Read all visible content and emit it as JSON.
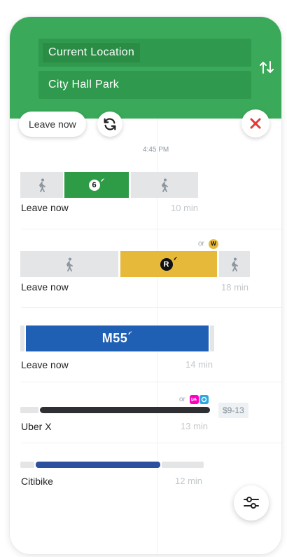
{
  "header": {
    "origin": "Current Location",
    "destination": "City Hall Park"
  },
  "controls": {
    "leave_now": "Leave now"
  },
  "departure_time": "4:45 PM",
  "routes": [
    {
      "label": "Leave now",
      "duration": "10 min",
      "line": "6"
    },
    {
      "label": "Leave now",
      "duration": "18 min",
      "line": "R",
      "alt_prefix": "or",
      "alt_line": "W"
    },
    {
      "label": "Leave now",
      "duration": "14 min",
      "line": "M55"
    },
    {
      "label": "Uber X",
      "duration": "13 min",
      "alt_prefix": "or",
      "price": "$9-13"
    },
    {
      "label": "Citibike",
      "duration": "12 min"
    }
  ],
  "colors": {
    "header_green": "#3aa959",
    "line_6": "#2e9b47",
    "line_R": "#e6b93b",
    "bus_M55": "#1f5fb4",
    "uber": "#2e2f33",
    "citibike": "#2c4f9e",
    "close_red": "#e53935"
  },
  "icons": [
    "swap-arrows-icon",
    "refresh-icon",
    "close-icon",
    "walk-icon",
    "realtime-icon",
    "lyft-icon",
    "via-icon",
    "filter-icon"
  ]
}
